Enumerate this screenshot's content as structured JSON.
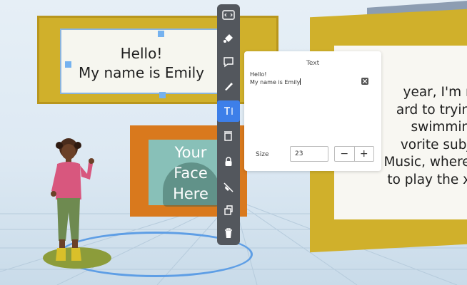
{
  "boards": {
    "hello": [
      "Hello!",
      "My name is Emily"
    ],
    "face": [
      "Your",
      "Face",
      "Here"
    ],
    "story": [
      "year, I'm m",
      "ard to trying",
      "swimming",
      "vorite subje",
      "is Music, where I",
      "to play the xy"
    ]
  },
  "toolbar": {
    "tools": [
      {
        "name": "code-icon",
        "active": false
      },
      {
        "name": "paint-bucket-icon",
        "active": false
      },
      {
        "name": "speech-bubble-icon",
        "active": false
      },
      {
        "name": "pen-icon",
        "active": false
      },
      {
        "name": "text-tool-icon",
        "active": true,
        "label": "T|"
      },
      {
        "name": "frame-icon",
        "active": false
      },
      {
        "name": "lock-icon",
        "active": false
      },
      {
        "name": "hide-icon",
        "active": false
      },
      {
        "name": "duplicate-icon",
        "active": false
      },
      {
        "name": "trash-icon",
        "active": false
      }
    ],
    "colors": {
      "bar": "#53575d",
      "active": "#3d7fe9"
    }
  },
  "text_panel": {
    "title": "Text",
    "value_lines": [
      "Hello!",
      "My name is Emily"
    ],
    "size_label": "Size",
    "size_value": "23",
    "decrement": "−",
    "increment": "+"
  }
}
